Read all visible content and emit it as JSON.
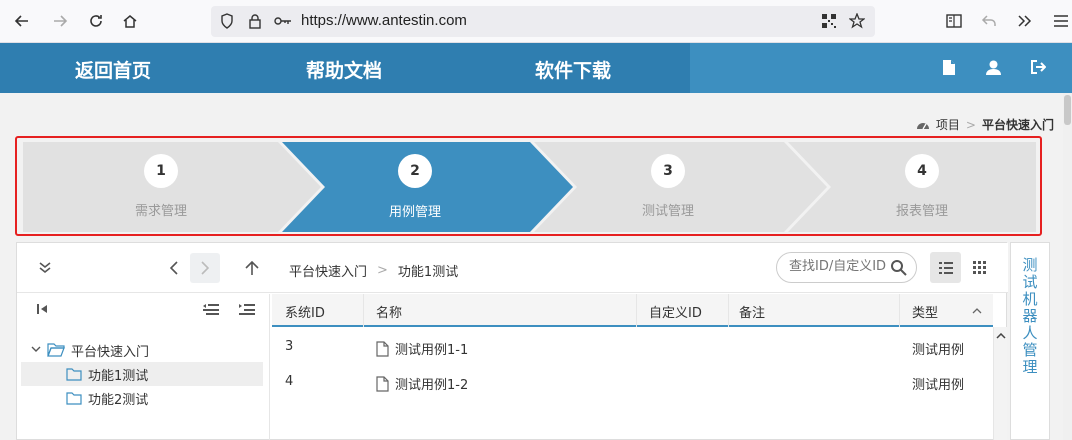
{
  "browser": {
    "url": "https://www.antestin.com"
  },
  "nav": {
    "items": [
      "返回首页",
      "帮助文档",
      "软件下载"
    ]
  },
  "breadcrumb_top": {
    "items": [
      "项目",
      "平台快速入门"
    ]
  },
  "steps": [
    {
      "num": "1",
      "label": "需求管理",
      "active": false
    },
    {
      "num": "2",
      "label": "用例管理",
      "active": true
    },
    {
      "num": "3",
      "label": "测试管理",
      "active": false
    },
    {
      "num": "4",
      "label": "报表管理",
      "active": false
    }
  ],
  "toolbar": {
    "path": [
      "平台快速入门",
      "功能1测试"
    ],
    "search_placeholder": "查找ID/自定义ID"
  },
  "tree": {
    "root": "平台快速入门",
    "children": [
      "功能1测试",
      "功能2测试"
    ],
    "selected_index": 0
  },
  "table": {
    "columns": [
      "系统ID",
      "名称",
      "自定义ID",
      "备注",
      "类型"
    ],
    "rows": [
      {
        "id": "3",
        "name": "测试用例1-1",
        "custom_id": "",
        "note": "",
        "type": "测试用例"
      },
      {
        "id": "4",
        "name": "测试用例1-2",
        "custom_id": "",
        "note": "",
        "type": "测试用例"
      }
    ]
  },
  "side_tab": {
    "label": "测试机器人管理"
  },
  "colors": {
    "nav_blue": "#2f7eb0",
    "active_step": "#3d8fc0",
    "highlight_border": "#e62020"
  }
}
